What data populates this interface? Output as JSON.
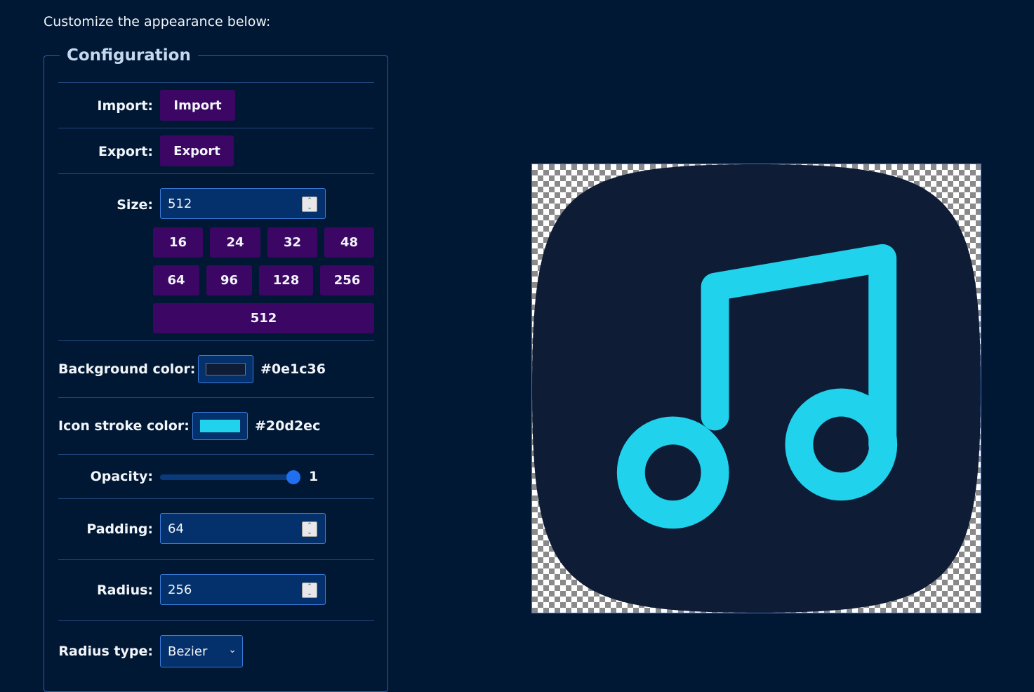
{
  "intro": "Customize the appearance below:",
  "config": {
    "legend": "Configuration",
    "import": {
      "label": "Import:",
      "button": "Import"
    },
    "export": {
      "label": "Export:",
      "button": "Export"
    },
    "size": {
      "label": "Size:",
      "value": "512",
      "presets": [
        "16",
        "24",
        "32",
        "48",
        "64",
        "96",
        "128",
        "256",
        "512"
      ]
    },
    "background_color": {
      "label": "Background color:",
      "value": "#0e1c36"
    },
    "stroke_color": {
      "label": "Icon stroke color:",
      "value": "#20d2ec"
    },
    "opacity": {
      "label": "Opacity:",
      "value": "1"
    },
    "padding": {
      "label": "Padding:",
      "value": "64"
    },
    "radius": {
      "label": "Radius:",
      "value": "256"
    },
    "radius_type": {
      "label": "Radius type:",
      "value": "Bezier"
    }
  },
  "preview": {
    "icon": "music-note-icon",
    "background": "#0e1c36",
    "stroke": "#20d2ec"
  }
}
